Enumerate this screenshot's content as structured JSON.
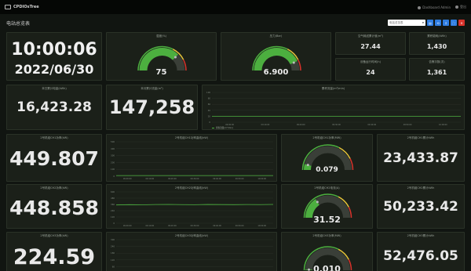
{
  "app": {
    "brand": "CPDIOsTree"
  },
  "topbar": {
    "user": "Dashboard Admin",
    "exit": "登出"
  },
  "page": {
    "title": "电站总览表"
  },
  "toolbar": {
    "search_placeholder": "电站总览表",
    "btn1": "▤",
    "btn2": "⟲",
    "btn3": "↧",
    "btn4": "⛶",
    "btn5": "✕"
  },
  "clock": {
    "time": "10:00:06",
    "date": "2022/06/30"
  },
  "gauge1": {
    "title": "湿度(%)",
    "value": "75",
    "min": 0,
    "max": 100,
    "current": 75,
    "color": "#4caf3f"
  },
  "gauge2": {
    "title": "压力(Bar)",
    "value": "6.900",
    "min": 0,
    "max": 8,
    "current": 6.9,
    "color": "#4caf3f"
  },
  "kpi_small": [
    {
      "title": "空气输送累计值(m³)",
      "value": "27.44"
    },
    {
      "title": "累积能耗(kWh)",
      "value": "1,430"
    },
    {
      "title": "设备运行时间(h)",
      "value": "24"
    },
    {
      "title": "告警次数(次)",
      "value": "1,361"
    }
  ],
  "row2": {
    "kpi1": {
      "title": "本日累计电量(kWh)",
      "value": "16,423.28"
    },
    "kpi2": {
      "title": "本月累计流量(m³)",
      "value": "147,258"
    },
    "trend": {
      "title": "累积流量(m³/min)",
      "legend": "累积流量(m³/min)"
    }
  },
  "row3": {
    "left": {
      "title": "2号机组CH1功率(kW)",
      "value": "449.807"
    },
    "chart": {
      "title": "2号机组CH1功率曲线(kW)"
    },
    "gauge": {
      "title": "2号机组CH1功率(MW)",
      "value": "0.079",
      "current": 0.079,
      "min": 0,
      "max": 1,
      "color": "#4caf3f"
    },
    "right": {
      "title": "2号机组CH1累计kWh",
      "value": "23,433.87"
    }
  },
  "row4": {
    "left": {
      "title": "2号机组CH2功率(kW)",
      "value": "448.858"
    },
    "chart": {
      "title": "2号机组CH2功率曲线(kW)"
    },
    "gauge": {
      "title": "2号机组CH2电流(A)",
      "value": "31.52",
      "current": 31.52,
      "min": 0,
      "max": 100,
      "color": "#4caf3f"
    },
    "right": {
      "title": "2号机组CH2累计kWh",
      "value": "50,233.42"
    }
  },
  "row5": {
    "left": {
      "title": "2号机组CH3功率(kW)",
      "value": "224.59"
    },
    "chart": {
      "title": "2号机组CH3功率曲线(kW)"
    },
    "gauge": {
      "title": "2号机组CH3功率(MW)",
      "value": "0.010",
      "current": 0.01,
      "min": 0,
      "max": 1,
      "color": "#4caf3f"
    },
    "right": {
      "title": "2号机组CH3累计kWh",
      "value": "52,476.05"
    }
  },
  "chart_xticks": [
    "09:00:00",
    "09:10:00",
    "09:20:00",
    "09:30:00",
    "09:40:00",
    "09:50:00",
    "10:00:00"
  ],
  "trend_series": {
    "name": "累积流量(m³/min)",
    "values": [
      20,
      20,
      20,
      20,
      20,
      20,
      20,
      20,
      20,
      20,
      20,
      20,
      20
    ],
    "ylim": [
      0,
      100
    ],
    "color": "#4caf3f"
  },
  "ch1_series": {
    "values": [
      10,
      10,
      10,
      10,
      10,
      10,
      10,
      10,
      10,
      10,
      10,
      10,
      10
    ],
    "ylim": [
      0,
      500
    ]
  },
  "ch2_series": {
    "values": [
      350,
      355,
      352,
      358,
      360,
      356,
      354,
      359,
      357,
      355,
      358,
      356,
      360
    ],
    "ylim": [
      0,
      600
    ]
  },
  "ch3_series": {
    "values": [
      10,
      10,
      10,
      10,
      10,
      10,
      10,
      10,
      10,
      10,
      10,
      10,
      10
    ],
    "ylim": [
      0,
      300
    ]
  }
}
